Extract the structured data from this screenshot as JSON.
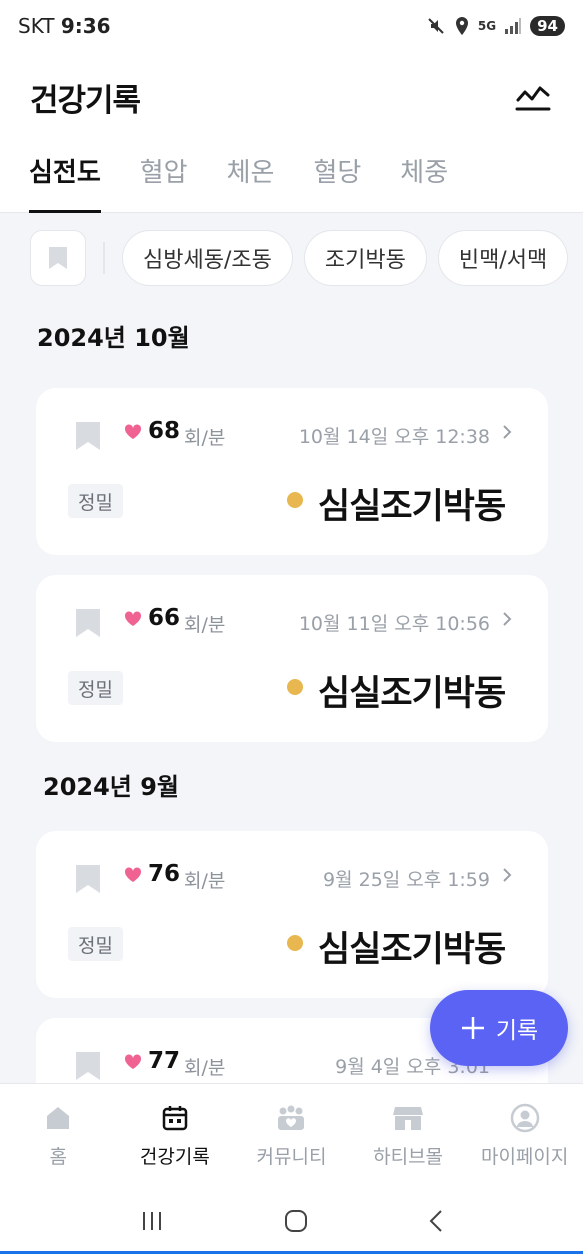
{
  "status_bar": {
    "carrier": "SKT",
    "time": "9:36",
    "network": "5G",
    "battery": "94"
  },
  "header": {
    "title": "건강기록"
  },
  "tabs": [
    {
      "label": "심전도",
      "active": true
    },
    {
      "label": "혈압"
    },
    {
      "label": "체온"
    },
    {
      "label": "혈당"
    },
    {
      "label": "체중"
    }
  ],
  "filters": [
    "심방세동/조동",
    "조기박동",
    "빈맥/서맥"
  ],
  "months": [
    "2024년 10월",
    "2024년 9월"
  ],
  "records": [
    {
      "bpm": "68",
      "unit": "회/분",
      "datetime": "10월 14일 오후 12:38",
      "tag": "정밀",
      "result": "심실조기박동"
    },
    {
      "bpm": "66",
      "unit": "회/분",
      "datetime": "10월 11일 오후 10:56",
      "tag": "정밀",
      "result": "심실조기박동"
    },
    {
      "bpm": "76",
      "unit": "회/분",
      "datetime": "9월 25일 오후 1:59",
      "tag": "정밀",
      "result": "심실조기박동"
    },
    {
      "bpm": "77",
      "unit": "회/분",
      "datetime": "9월 4일 오후 3:01",
      "tag": "",
      "result": ""
    }
  ],
  "fab": {
    "label": "기록"
  },
  "bottom_nav": [
    {
      "label": "홈",
      "icon": "home-icon"
    },
    {
      "label": "건강기록",
      "icon": "calendar-icon",
      "active": true
    },
    {
      "label": "커뮤니티",
      "icon": "community-icon"
    },
    {
      "label": "하티브몰",
      "icon": "store-icon"
    },
    {
      "label": "마이페이지",
      "icon": "profile-icon"
    }
  ],
  "colors": {
    "accent": "#5a63f4",
    "result_dot": "#e8b74f",
    "heart": "#f06292"
  }
}
